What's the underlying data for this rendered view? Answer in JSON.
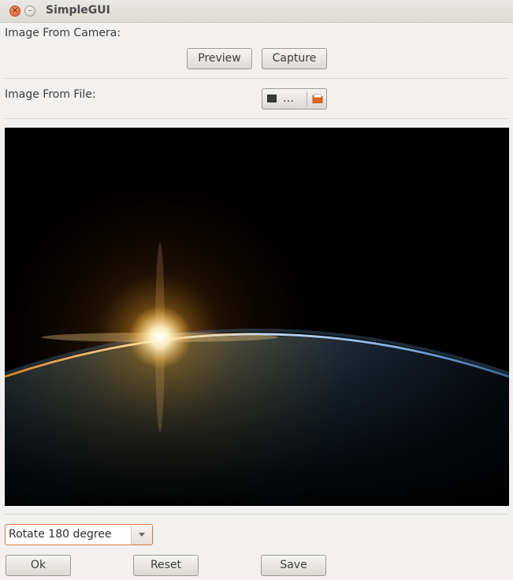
{
  "window": {
    "title": "SimpleGUI",
    "close_glyph": "×",
    "minimize_glyph": "–"
  },
  "camera": {
    "label": "Image From Camera:",
    "preview_label": "Preview",
    "capture_label": "Capture"
  },
  "file": {
    "label": "Image From File:",
    "chooser_text": "…",
    "icons": [
      "document-icon",
      "folder-icon"
    ]
  },
  "image": {
    "description_icon": "earth-sunrise-image"
  },
  "controls": {
    "rotate_selected": "Rotate 180 degree",
    "ok_label": "Ok",
    "reset_label": "Reset",
    "save_label": "Save"
  },
  "colors": {
    "close_button": "#e35a2c",
    "combo_focus_border": "#e0763a",
    "image_background": "#000000"
  }
}
